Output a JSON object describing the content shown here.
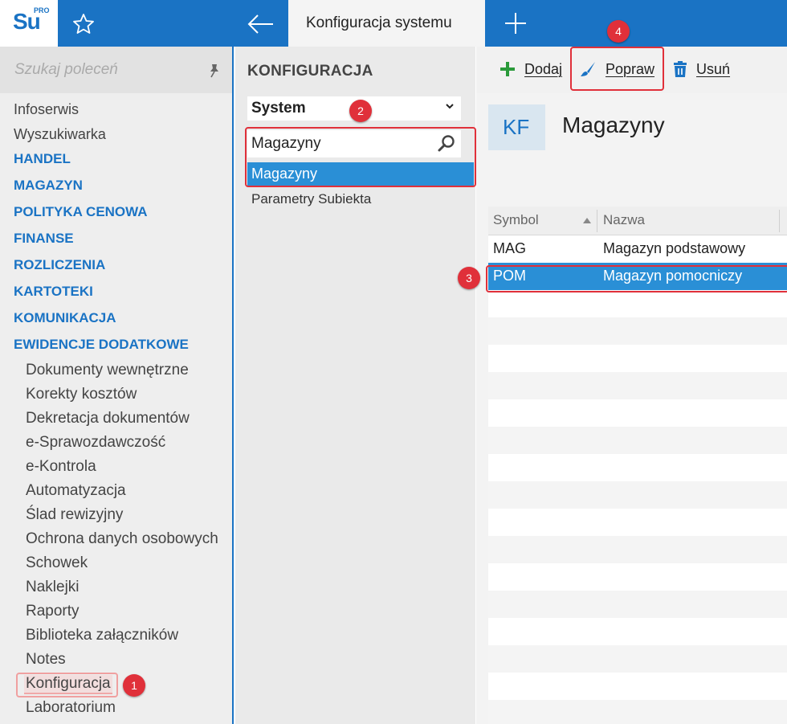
{
  "topbar": {
    "logo_text": "Su",
    "logo_sup": "PRO",
    "active_tab": "Konfiguracja systemu"
  },
  "sidebar": {
    "search_placeholder": "Szukaj poleceń",
    "items": [
      {
        "label": "Infoserwis",
        "type": "item"
      },
      {
        "label": "Wyszukiwarka",
        "type": "item"
      },
      {
        "label": "HANDEL",
        "type": "section"
      },
      {
        "label": "MAGAZYN",
        "type": "section"
      },
      {
        "label": "POLITYKA CENOWA",
        "type": "section"
      },
      {
        "label": "FINANSE",
        "type": "section"
      },
      {
        "label": "ROZLICZENIA",
        "type": "section"
      },
      {
        "label": "KARTOTEKI",
        "type": "section"
      },
      {
        "label": "KOMUNIKACJA",
        "type": "section"
      },
      {
        "label": "EWIDENCJE DODATKOWE",
        "type": "section"
      },
      {
        "label": "Dokumenty wewnętrzne",
        "type": "sub"
      },
      {
        "label": "Korekty kosztów",
        "type": "sub"
      },
      {
        "label": "Dekretacja dokumentów",
        "type": "sub"
      },
      {
        "label": "e-Sprawozdawczość",
        "type": "sub"
      },
      {
        "label": "e-Kontrola",
        "type": "sub"
      },
      {
        "label": "Automatyzacja",
        "type": "sub"
      },
      {
        "label": "Ślad rewizyjny",
        "type": "sub"
      },
      {
        "label": "Ochrona danych osobowych",
        "type": "sub"
      },
      {
        "label": "Schowek",
        "type": "sub"
      },
      {
        "label": "Naklejki",
        "type": "sub"
      },
      {
        "label": "Raporty",
        "type": "sub"
      },
      {
        "label": "Biblioteka załączników",
        "type": "sub"
      },
      {
        "label": "Notes",
        "type": "sub"
      },
      {
        "label": "Konfiguracja",
        "type": "sub",
        "selected": true
      },
      {
        "label": "Laboratorium",
        "type": "sub"
      }
    ]
  },
  "config_panel": {
    "title": "KONFIGURACJA",
    "category_select": "System",
    "filter_value": "Magazyny",
    "selected_item": "Magazyny",
    "other_item": "Parametry Subiekta"
  },
  "toolbar": {
    "add_label": "Dodaj",
    "edit_label": "Popraw",
    "delete_label": "Usuń"
  },
  "main": {
    "badge": "KF",
    "title": "Magazyny",
    "columns": [
      "Symbol",
      "Nazwa"
    ],
    "rows": [
      {
        "symbol": "MAG",
        "name": "Magazyn podstawowy",
        "selected": false
      },
      {
        "symbol": "POM",
        "name": "Magazyn pomocniczy",
        "selected": true
      }
    ]
  },
  "markers": [
    "1",
    "2",
    "3",
    "4"
  ],
  "colors": {
    "brand_blue": "#1a73c4",
    "selection_blue": "#2a8fd6",
    "annotation_red": "#e0303a",
    "add_green": "#2a9a3a"
  }
}
